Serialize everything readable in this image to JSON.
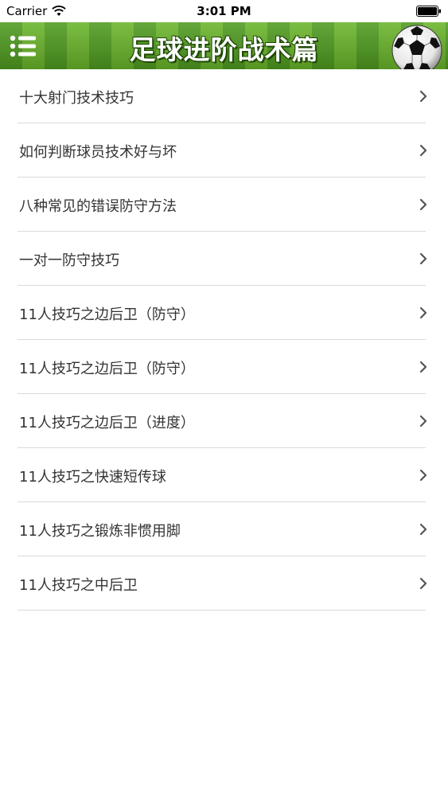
{
  "status_bar": {
    "carrier": "Carrier",
    "time": "3:01 PM"
  },
  "header": {
    "title": "足球进阶战术篇"
  },
  "colors": {
    "grass_dark": "#4f9b1f",
    "grass_light": "#6ab52a",
    "title_text": "#ffffff",
    "item_text": "#333333",
    "separator": "#d9d9d9"
  },
  "list": {
    "items": [
      {
        "label": "十大射门技术技巧"
      },
      {
        "label": "如何判断球员技术好与坏"
      },
      {
        "label": "八种常见的错误防守方法"
      },
      {
        "label": "一对一防守技巧"
      },
      {
        "label": "11人技巧之边后卫（防守）"
      },
      {
        "label": "11人技巧之边后卫（防守）"
      },
      {
        "label": "11人技巧之边后卫（进度）"
      },
      {
        "label": "11人技巧之快速短传球"
      },
      {
        "label": "11人技巧之锻炼非惯用脚"
      },
      {
        "label": "11人技巧之中后卫"
      }
    ]
  }
}
